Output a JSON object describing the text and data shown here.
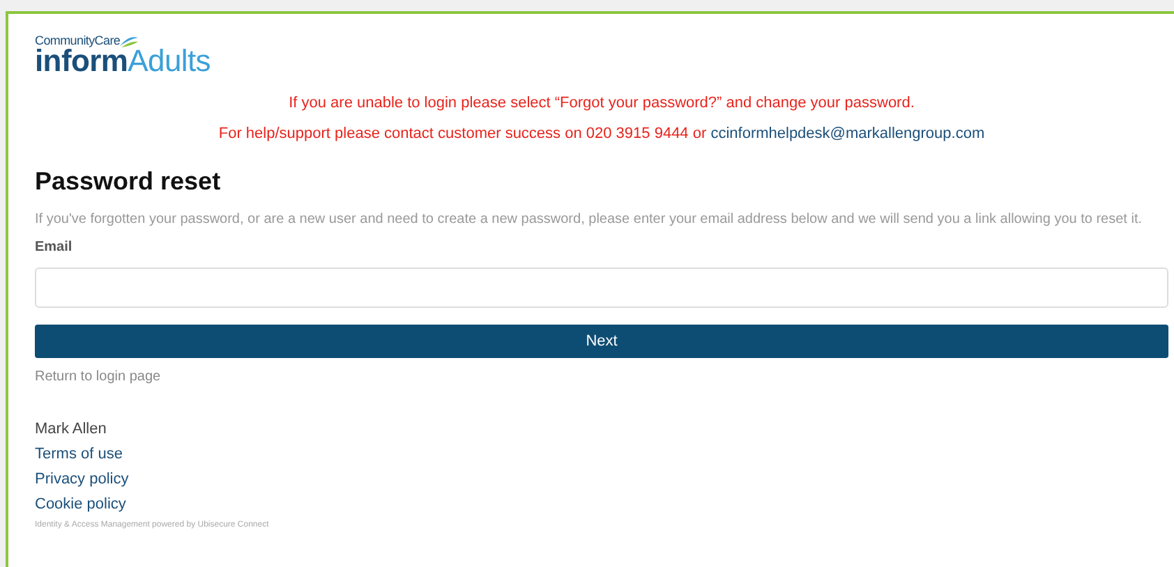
{
  "logo": {
    "brand": "CommunityCare",
    "product_bold": "inform",
    "product_light": "Adults"
  },
  "notices": [
    {
      "text": "If you are unable to login please select “Forgot your password?” and change your password."
    },
    {
      "text": "For help/support please contact customer success on 020 3915 9444 or ",
      "link": "ccinformhelpdesk@markallengroup.com"
    }
  ],
  "heading": "Password reset",
  "description": "If you've forgotten your password, or are a new user and need to create a new password, please enter your email address below and we will send you a link allowing you to reset it.",
  "email_field": {
    "label": "Email"
  },
  "next_button": "Next",
  "return_link": "Return to login page",
  "company": "Mark Allen",
  "footer_links": [
    "Terms of use",
    "Privacy policy",
    "Cookie policy"
  ],
  "powered_by": "Identity & Access Management powered by Ubisecure Connect"
}
